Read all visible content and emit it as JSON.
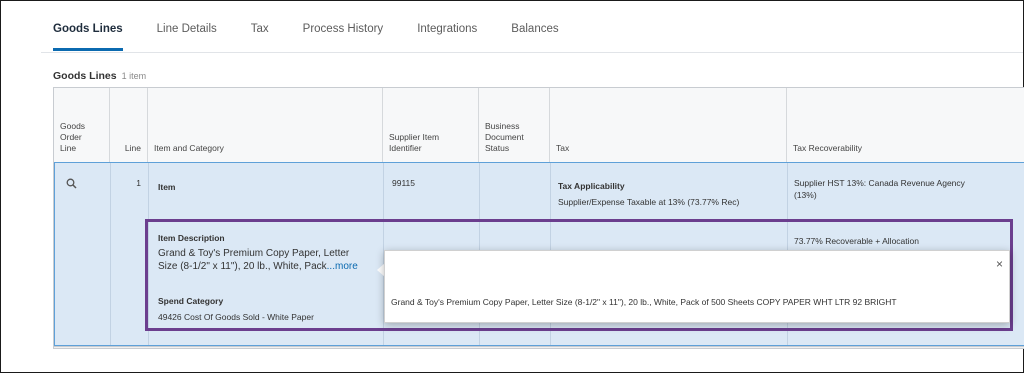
{
  "tabs": [
    {
      "label": "Goods Lines",
      "active": true
    },
    {
      "label": "Line Details",
      "active": false
    },
    {
      "label": "Tax",
      "active": false
    },
    {
      "label": "Process History",
      "active": false
    },
    {
      "label": "Integrations",
      "active": false
    },
    {
      "label": "Balances",
      "active": false
    }
  ],
  "section": {
    "title": "Goods Lines",
    "count": "1 item"
  },
  "columns": {
    "goods_order_line": [
      "Goods",
      "Order",
      "Line"
    ],
    "line": "Line",
    "item_and_category": "Item and Category",
    "supplier_item_identifier": [
      "Supplier Item",
      "Identifier"
    ],
    "business_document_status": [
      "Business",
      "Document",
      "Status"
    ],
    "tax": "Tax",
    "tax_recoverability": "Tax Recoverability"
  },
  "row": {
    "line_number": "1",
    "item_label": "Item",
    "supplier_item_id": "99115",
    "tax_applicability_label": "Tax Applicability",
    "tax_applicability_value": "Supplier/Expense Taxable at 13% (73.77% Rec)",
    "tax_recoverability_line1": "Supplier HST 13%: Canada Revenue Agency",
    "tax_recoverability_line2": "(13%)",
    "tax_recoverability_allocation": "73.77% Recoverable + Allocation",
    "item_description_label": "Item Description",
    "item_description_line1": "Grand & Toy's Premium Copy Paper, Letter",
    "item_description_line2": "Size (8-1/2\" x 11\"), 20 lb., White, Pack",
    "more_link": "...more",
    "spend_category_label": "Spend Category",
    "spend_category_value": "49426 Cost Of Goods Sold - White Paper"
  },
  "popup": {
    "full_text": "Grand & Toy's Premium Copy Paper, Letter Size (8-1/2\" x 11\"), 20 lb., White, Pack of 500 Sheets COPY PAPER WHT LTR 92 BRIGHT",
    "close_glyph": "×"
  },
  "icons": {
    "search": "search-icon",
    "close": "close-icon",
    "scroll_left": "chevron-left-icon"
  },
  "colors": {
    "accent": "#0b6ab0",
    "selected_row": "#dbe8f5",
    "highlight_border": "#6b3e8e"
  }
}
